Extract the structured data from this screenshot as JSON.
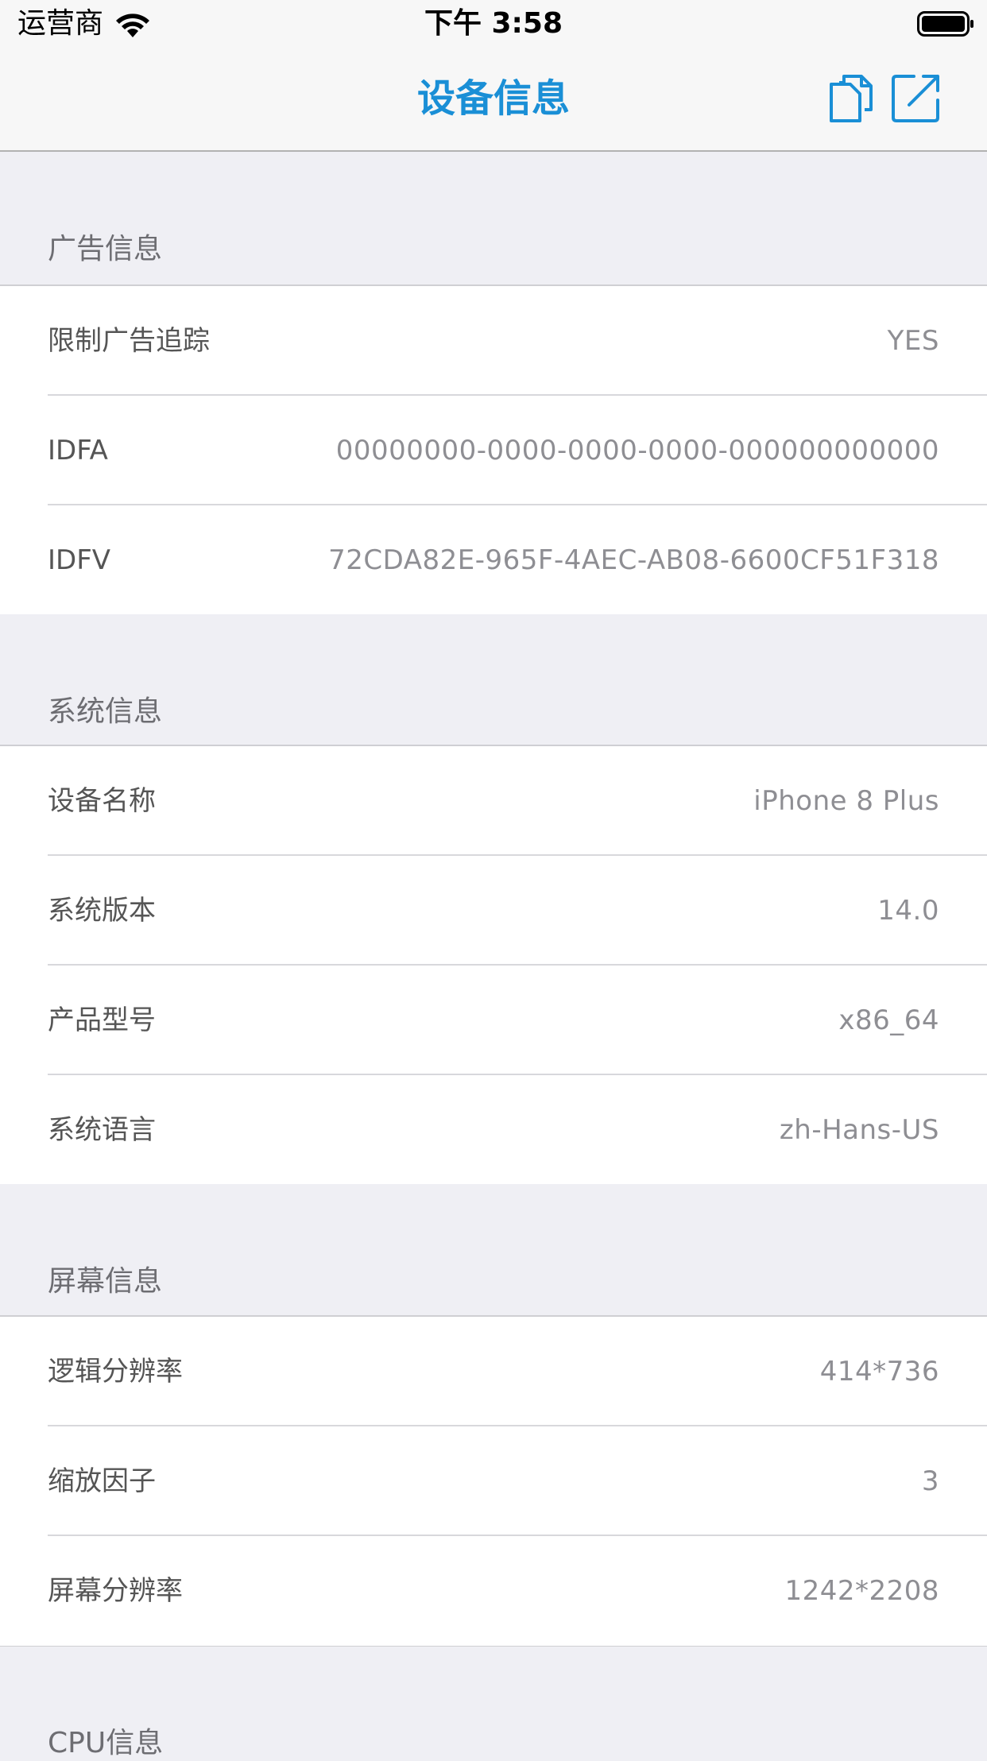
{
  "status_bar": {
    "carrier": "运营商",
    "time": "下午 3:58"
  },
  "nav": {
    "title": "设备信息",
    "copy_icon": "copy-icon",
    "share_icon": "share-icon",
    "accent_color": "#1a8fd6"
  },
  "sections": [
    {
      "title": "广告信息",
      "rows": [
        {
          "key": "限制广告追踪",
          "value": "YES"
        },
        {
          "key": "IDFA",
          "value": "00000000-0000-0000-0000-000000000000"
        },
        {
          "key": "IDFV",
          "value": "72CDA82E-965F-4AEC-AB08-6600CF51F318"
        }
      ]
    },
    {
      "title": "系统信息",
      "rows": [
        {
          "key": "设备名称",
          "value": "iPhone 8 Plus"
        },
        {
          "key": "系统版本",
          "value": "14.0"
        },
        {
          "key": "产品型号",
          "value": "x86_64"
        },
        {
          "key": "系统语言",
          "value": "zh-Hans-US"
        }
      ]
    },
    {
      "title": "屏幕信息",
      "rows": [
        {
          "key": "逻辑分辨率",
          "value": "414*736"
        },
        {
          "key": "缩放因子",
          "value": "3"
        },
        {
          "key": "屏幕分辨率",
          "value": "1242*2208"
        }
      ]
    },
    {
      "title": "CPU信息",
      "rows": []
    }
  ]
}
